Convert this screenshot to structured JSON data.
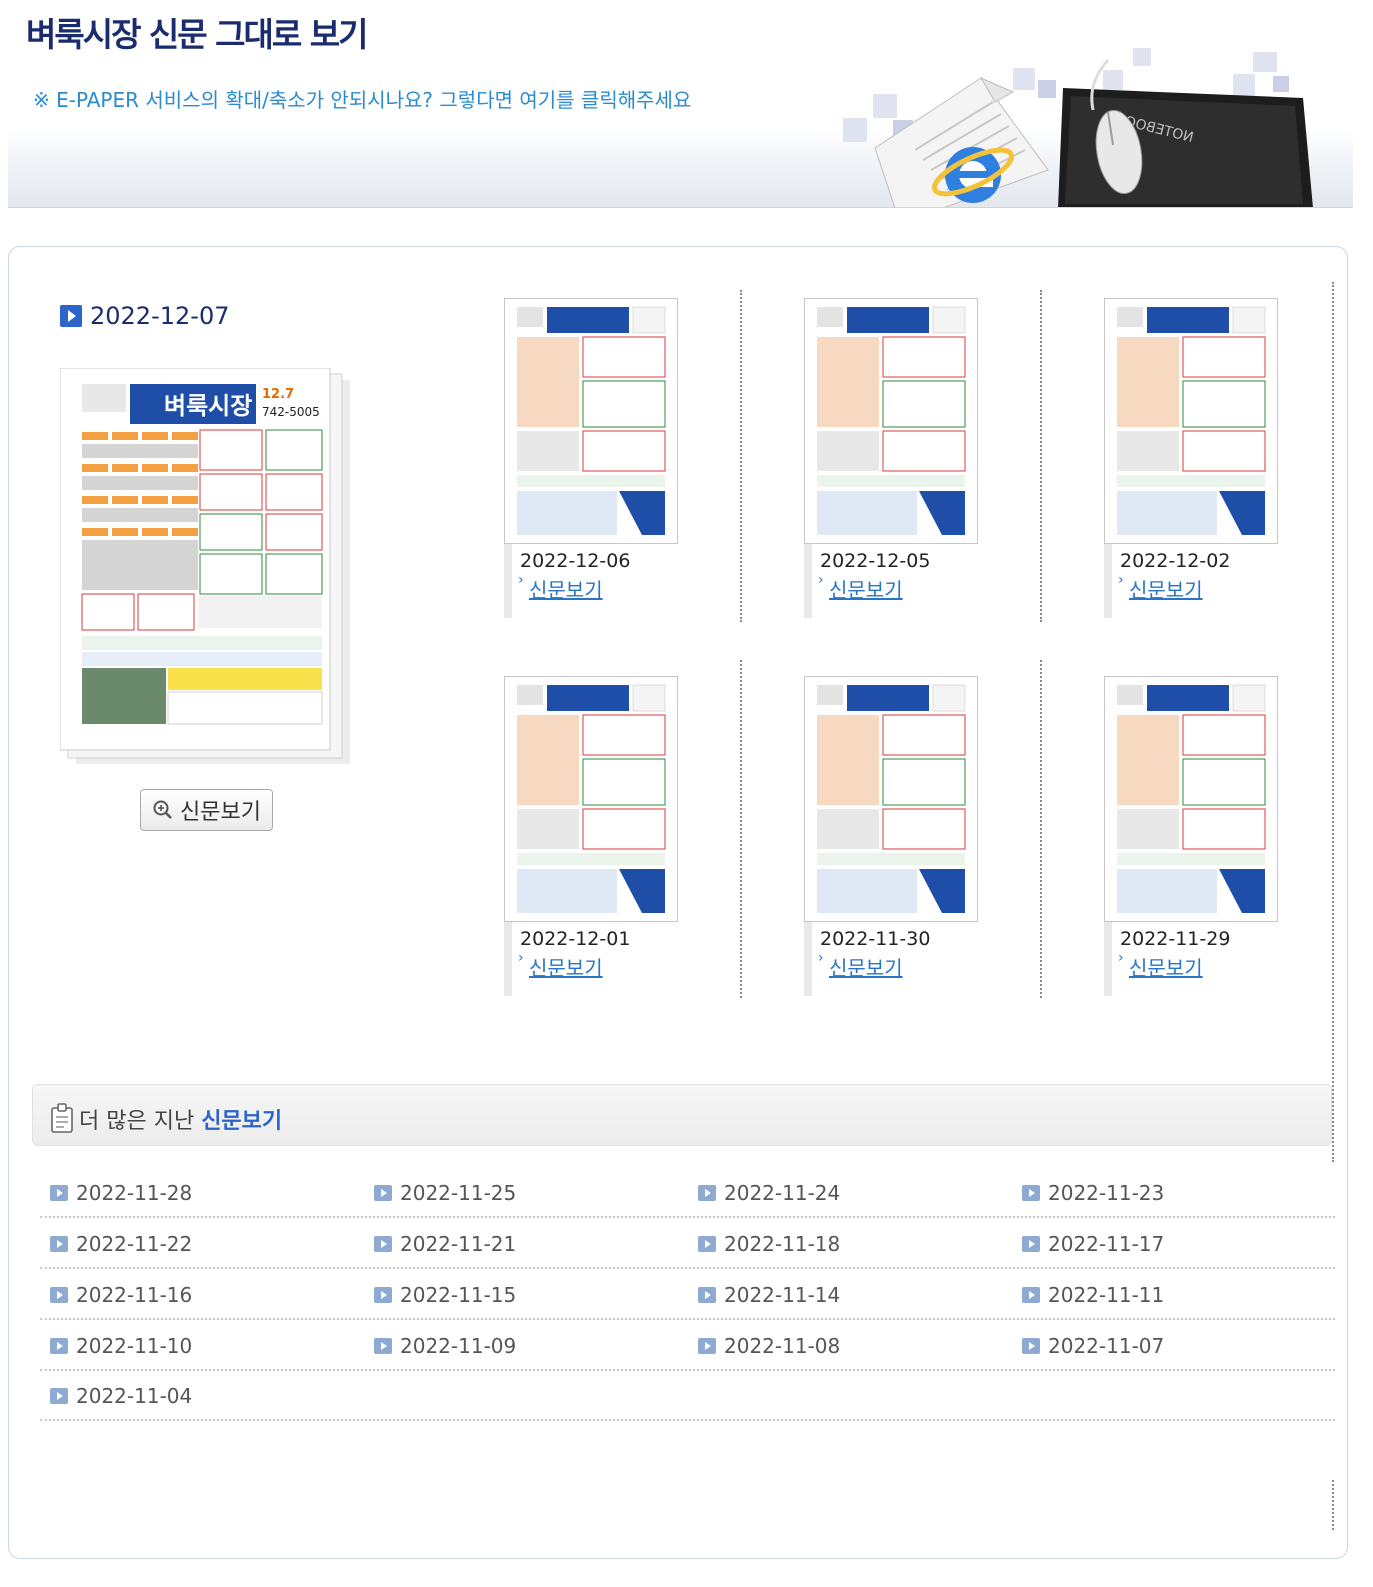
{
  "header": {
    "title": "벼룩시장 신문 그대로 보기",
    "notice": "※ E-PAPER 서비스의 확대/축소가 안되시나요? 그렇다면 여기를 클릭해주세요",
    "notebook_label": "NOTEBOOK"
  },
  "latest": {
    "date": "2022-12-07",
    "button_label": "신문보기"
  },
  "recent": [
    {
      "date": "2022-12-06",
      "link": "신문보기"
    },
    {
      "date": "2022-12-05",
      "link": "신문보기"
    },
    {
      "date": "2022-12-02",
      "link": "신문보기"
    },
    {
      "date": "2022-12-01",
      "link": "신문보기"
    },
    {
      "date": "2022-11-30",
      "link": "신문보기"
    },
    {
      "date": "2022-11-29",
      "link": "신문보기"
    }
  ],
  "archive": {
    "heading_prefix": "더 많은 지난",
    "heading_highlight": "신문보기",
    "dates": [
      "2022-11-28",
      "2022-11-25",
      "2022-11-24",
      "2022-11-23",
      "2022-11-22",
      "2022-11-21",
      "2022-11-18",
      "2022-11-17",
      "2022-11-16",
      "2022-11-15",
      "2022-11-14",
      "2022-11-11",
      "2022-11-10",
      "2022-11-09",
      "2022-11-08",
      "2022-11-07",
      "2022-11-04"
    ]
  },
  "colors": {
    "title": "#1a2b6e",
    "notice": "#2a8bd1",
    "link": "#2874c8",
    "accent": "#2c64c9"
  },
  "icons": {
    "latest_marker": "arrow-right-icon",
    "button": "zoom-icon",
    "archive_heading": "clipboard-icon",
    "archive_item": "arrow-right-icon"
  }
}
